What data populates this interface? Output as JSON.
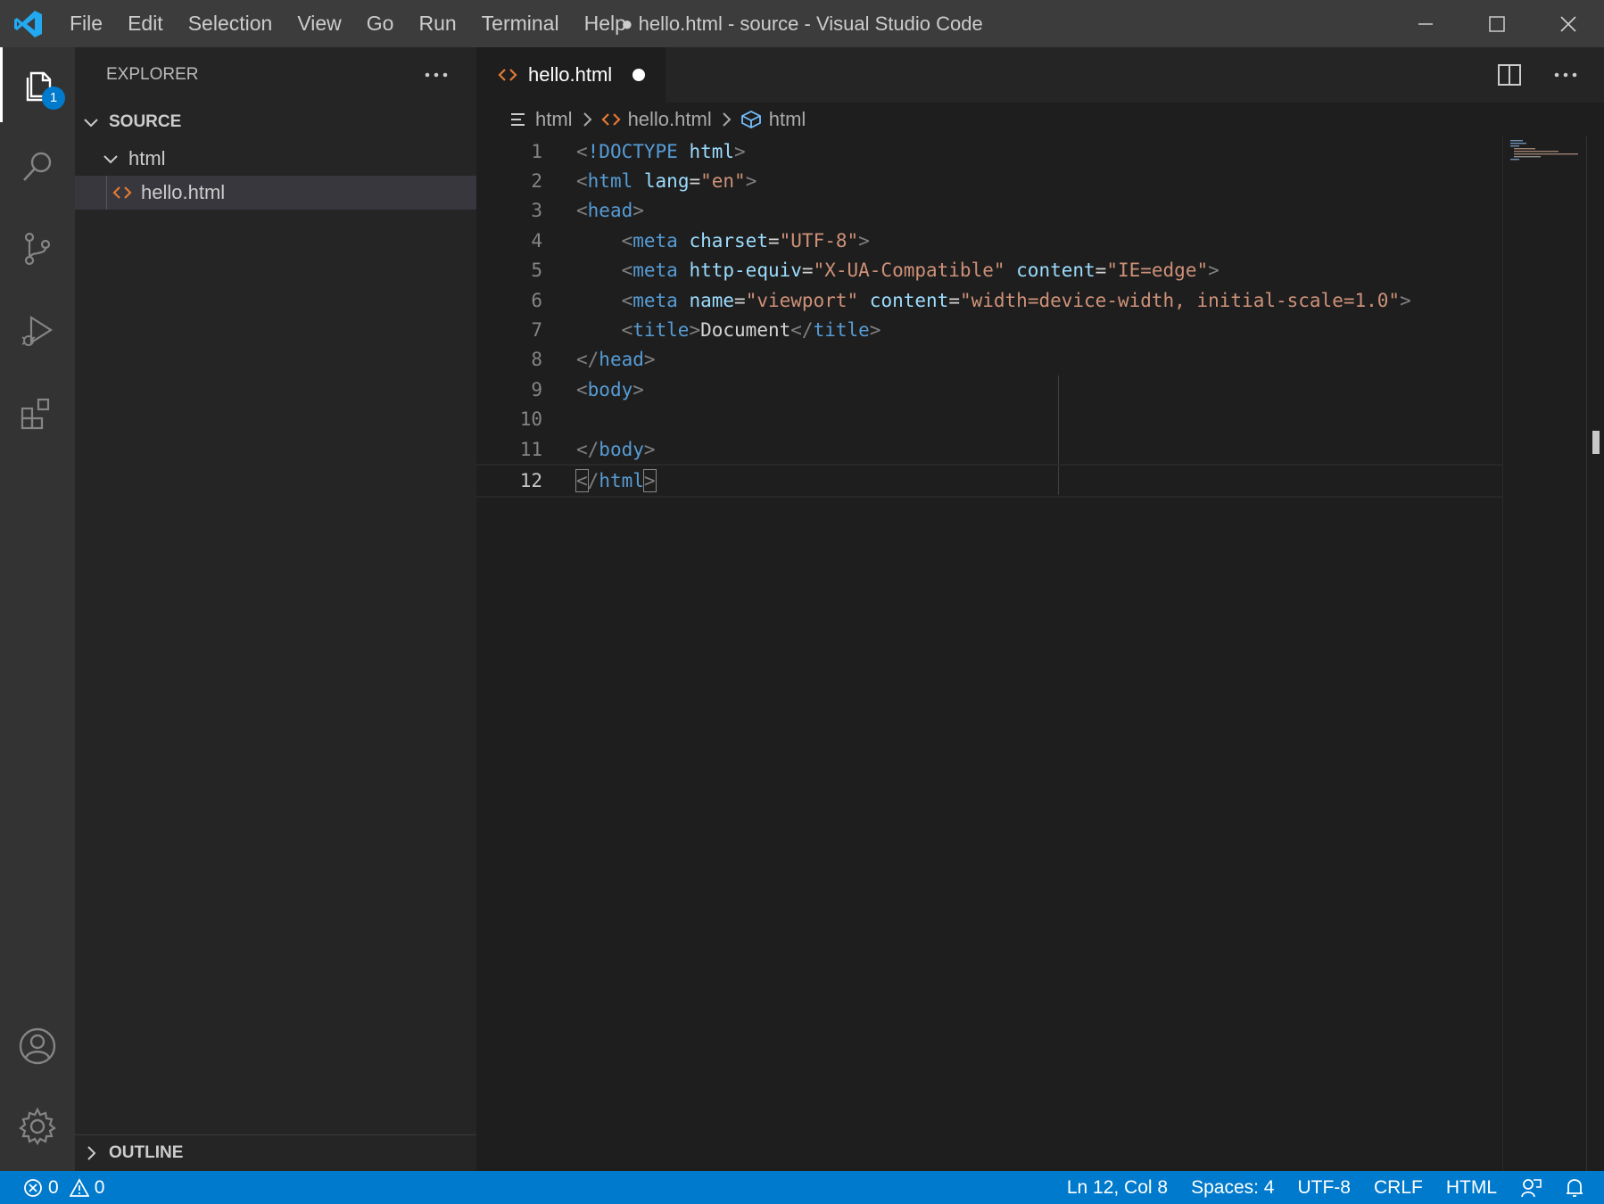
{
  "titlebar": {
    "menu": [
      "File",
      "Edit",
      "Selection",
      "View",
      "Go",
      "Run",
      "Terminal",
      "Help"
    ],
    "window_title": "● hello.html - source - Visual Studio Code"
  },
  "activity": {
    "explorer_badge": "1"
  },
  "sidebar": {
    "title": "EXPLORER",
    "section": "SOURCE",
    "folder": "html",
    "file": "hello.html",
    "outline": "OUTLINE"
  },
  "editor": {
    "tab_label": "hello.html",
    "breadcrumbs": [
      "html",
      "hello.html",
      "html"
    ],
    "line_numbers": [
      "1",
      "2",
      "3",
      "4",
      "5",
      "6",
      "7",
      "8",
      "9",
      "10",
      "11",
      "12"
    ],
    "lines": [
      "<!DOCTYPE html>",
      "<html lang=\"en\">",
      "<head>",
      "    <meta charset=\"UTF-8\">",
      "    <meta http-equiv=\"X-UA-Compatible\" content=\"IE=edge\">",
      "    <meta name=\"viewport\" content=\"width=device-width, initial-scale=1.0\">",
      "    <title>Document</title>",
      "</head>",
      "<body>",
      "",
      "</body>",
      "</html>"
    ]
  },
  "statusbar": {
    "errors": "0",
    "warnings": "0",
    "position": "Ln 12, Col 8",
    "spaces": "Spaces: 4",
    "encoding": "UTF-8",
    "eol": "CRLF",
    "language": "HTML"
  },
  "colors": {
    "accent": "#007acc",
    "tag": "#569cd6",
    "attr": "#9cdcfe",
    "string": "#ce9178",
    "file_icon": "#e37933"
  }
}
